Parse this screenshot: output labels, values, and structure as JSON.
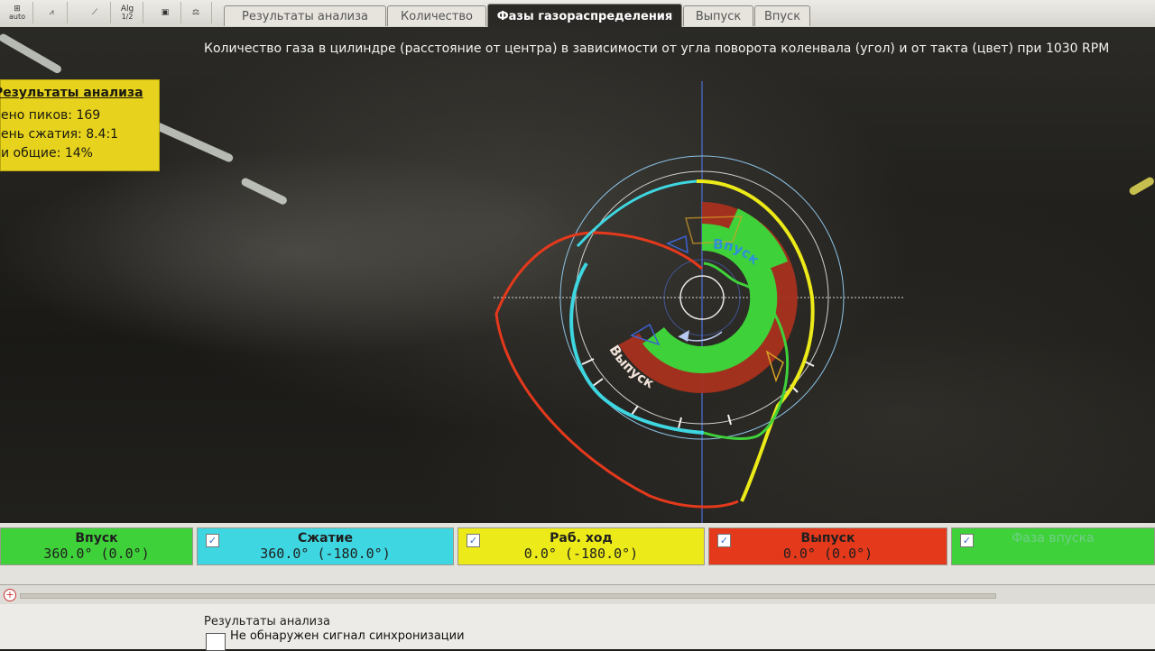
{
  "toolbar": {
    "icons": [
      {
        "name": "auto-scale-icon",
        "glyph": "⊞",
        "sub": "auto"
      },
      {
        "name": "signal-mode-icon",
        "glyph": "⩘",
        "sub": "⊿⊿"
      },
      {
        "name": "curve-tool-icon",
        "glyph": "⟋",
        "sub": ""
      },
      {
        "name": "algorithm-icon",
        "glyph": "Alg",
        "sub": "1/2"
      },
      {
        "name": "save-icon",
        "glyph": "▣",
        "sub": ""
      },
      {
        "name": "balance-icon",
        "glyph": "⚖",
        "sub": ""
      }
    ],
    "tabs": [
      {
        "label": "Результаты анализа",
        "active": false
      },
      {
        "label": "Количество",
        "active": false
      },
      {
        "label": "Фазы газораспределения",
        "active": true
      },
      {
        "label": "Выпуск",
        "active": false
      },
      {
        "label": "Впуск",
        "active": false
      }
    ]
  },
  "scope": {
    "title": "Количество газа в цилиндре (расстояние от центра) в зависимости от угла поворота коленвала (угол) и от такта (цвет) при 1030 RPM",
    "info": {
      "title": "Результаты анализа",
      "lines": [
        "ено пиков: 169",
        "ень сжатия: 8.4:1",
        "и общие: 14%"
      ]
    },
    "wheel_labels": {
      "intake": "Впуск",
      "exhaust": "Выпуск"
    }
  },
  "colors": {
    "intake": "#3fd13a",
    "compression": "#3ed6e0",
    "power": "#ecea18",
    "exhaust": "#e5391c",
    "exhaust_ring": "#a8301e",
    "phase": "#3fd13a"
  },
  "strokes": [
    {
      "name": "Впуск",
      "value": "360.0° (0.0°)",
      "color": "#3fd13a",
      "checkbox": false
    },
    {
      "name": "Сжатие",
      "value": "360.0° (-180.0°)",
      "color": "#3ed6e0",
      "checkbox": true
    },
    {
      "name": "Раб. ход",
      "value": "0.0° (-180.0°)",
      "color": "#ecea18",
      "checkbox": true
    },
    {
      "name": "Выпуск",
      "value": "0.0° (0.0°)",
      "color": "#e5391c",
      "checkbox": true
    },
    {
      "name": "Фаза впуска",
      "value": "",
      "color": "#3fd13a",
      "checkbox": true
    }
  ],
  "results": {
    "title": "Результаты анализа",
    "message": "Не обнаружен сигнал синхронизации"
  }
}
